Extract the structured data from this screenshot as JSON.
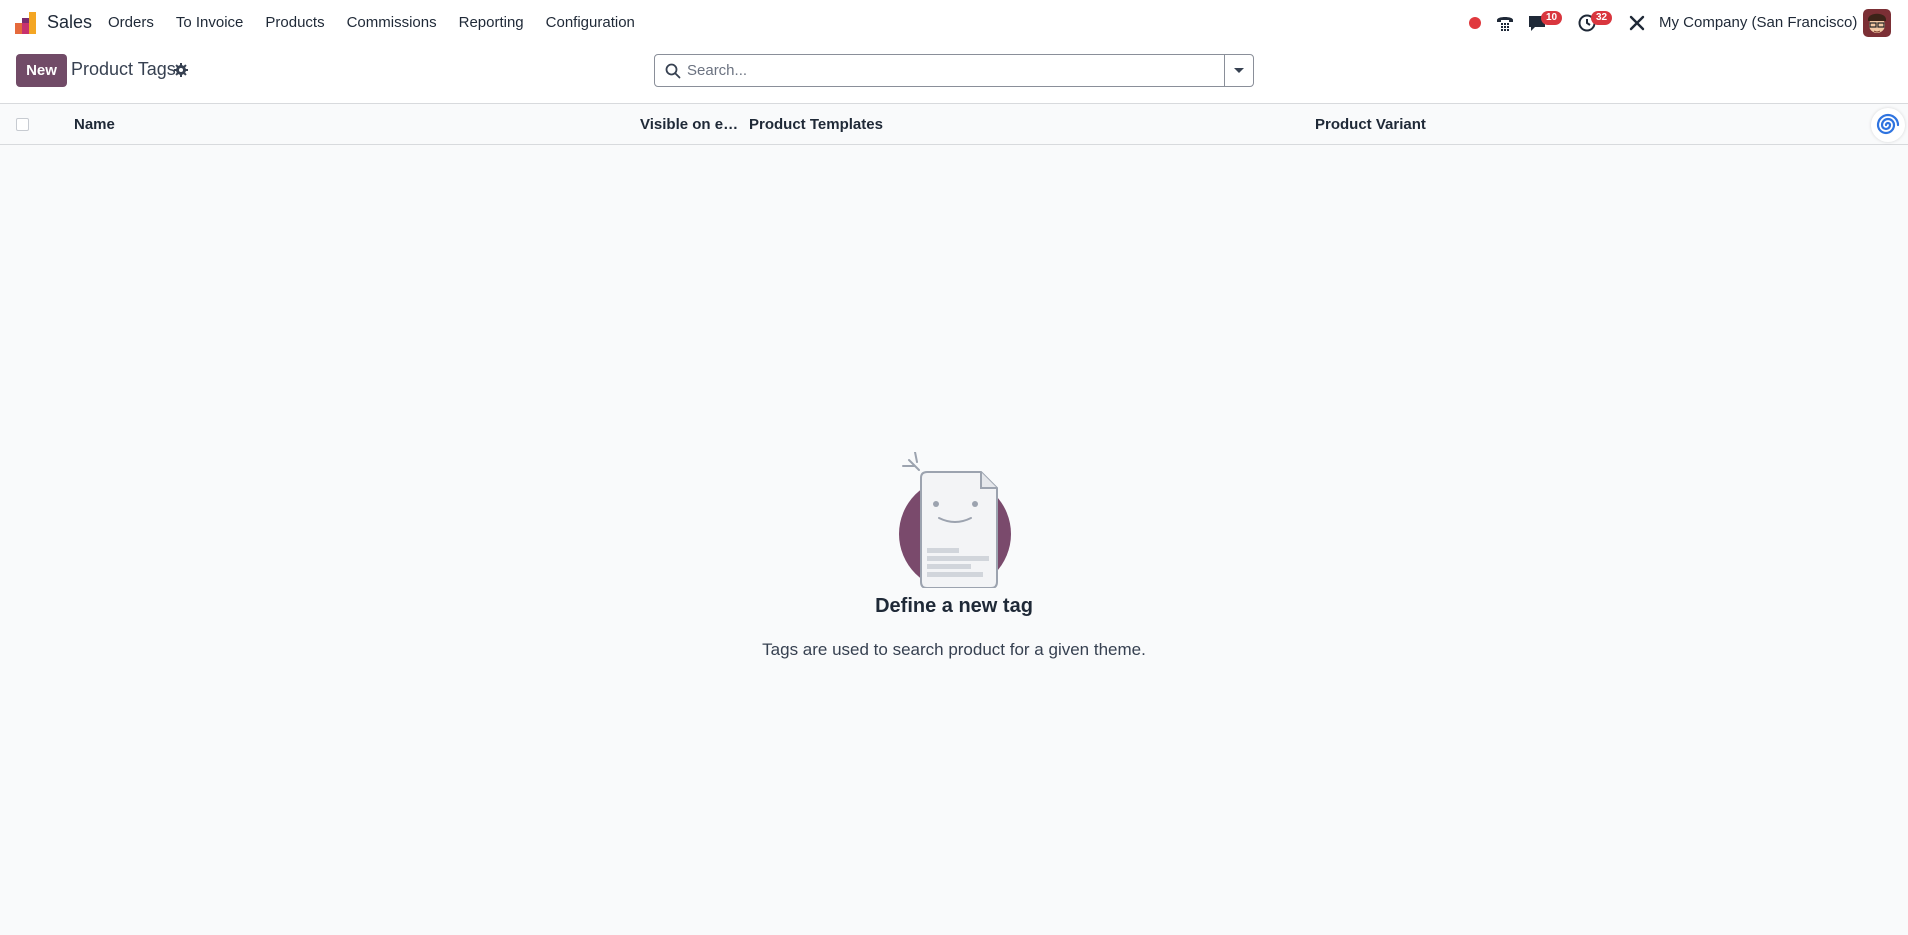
{
  "navbar": {
    "app_name": "Sales",
    "menu": [
      "Orders",
      "To Invoice",
      "Products",
      "Commissions",
      "Reporting",
      "Configuration"
    ],
    "messages_count": "10",
    "activities_count": "32",
    "company": "My Company (San Francisco)"
  },
  "control_panel": {
    "new_label": "New",
    "title": "Product Tags",
    "search_placeholder": "Search..."
  },
  "list": {
    "columns": [
      "Name",
      "Visible on eC...",
      "Product Templates",
      "Product Variant"
    ]
  },
  "empty_state": {
    "title": "Define a new tag",
    "description": "Tags are used to search product for a given theme."
  },
  "colors": {
    "brand": "#714b67",
    "badge": "#d9363e",
    "recording": "#e0393e"
  }
}
